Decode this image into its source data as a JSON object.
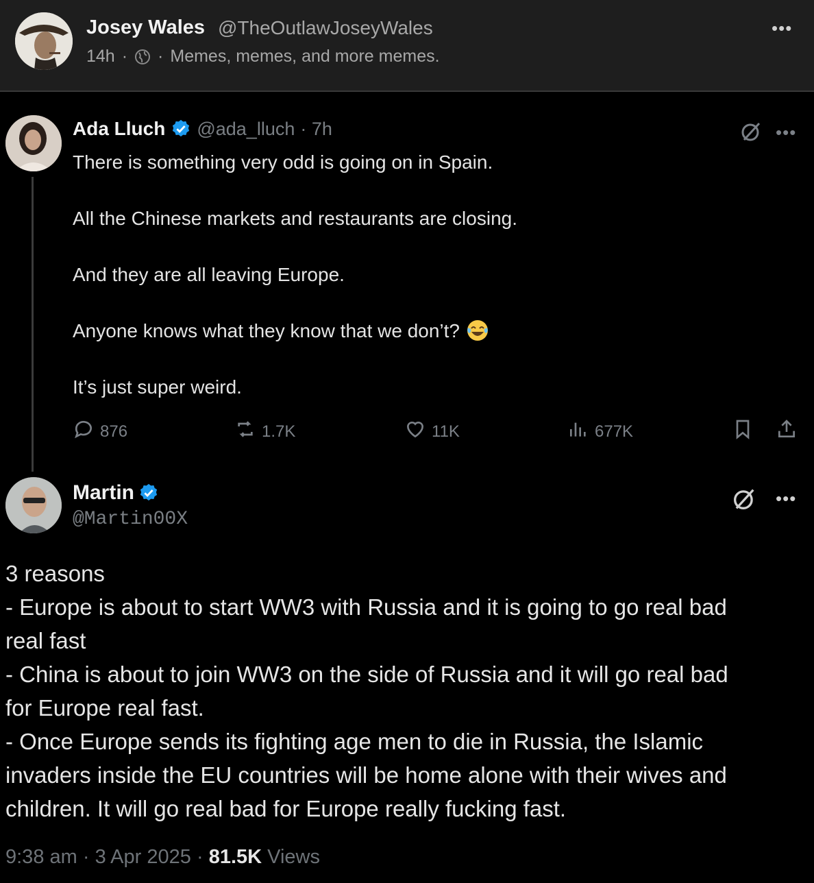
{
  "top_post": {
    "author_name": "Josey Wales",
    "author_handle": "@TheOutlawJoseyWales",
    "time": "14h",
    "separator": "·",
    "community": "Memes, memes, and more memes."
  },
  "tweet": {
    "author_name": "Ada Lluch",
    "author_handle": "@ada_lluch",
    "time": "· 7h",
    "paragraphs": [
      "There is something very odd is going on in Spain.",
      "All the Chinese markets and restaurants are closing.",
      "And they are all leaving Europe.",
      "Anyone knows what they know that we don’t?",
      "It’s just super weird."
    ],
    "stats": {
      "replies": "876",
      "reposts": "1.7K",
      "likes": "11K",
      "views": "677K"
    }
  },
  "reply": {
    "author_name": "Martin",
    "author_handle": "@Martin00X",
    "lines": [
      "3 reasons",
      "- Europe is about to start WW3 with Russia and it is going to go real bad",
      "real fast",
      "- China is about to join WW3 on the side of Russia and it will go real bad",
      "for Europe real fast.",
      "- Once Europe sends its fighting age men to die in Russia, the Islamic",
      "invaders inside the EU countries will be home alone with their wives and",
      "children. It will go real bad for Europe really fucking fast."
    ],
    "time": "9:38 am",
    "date": "3 Apr 2025",
    "sep": "·",
    "views_count": "81.5K",
    "views_label": "Views"
  },
  "colors": {
    "verified": "#1d9bf0",
    "header_bg": "#1e1e1e",
    "muted": "#7a7f84"
  }
}
